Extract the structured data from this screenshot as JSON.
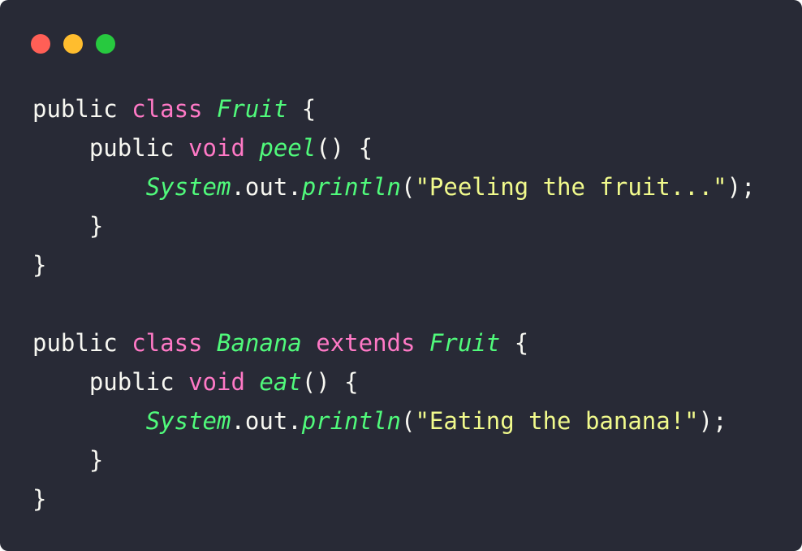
{
  "window": {
    "controls": [
      {
        "name": "close",
        "color": "#ff5f56"
      },
      {
        "name": "minimize",
        "color": "#ffbd2e"
      },
      {
        "name": "maximize",
        "color": "#27c93f"
      }
    ],
    "background": "#282a36"
  },
  "code": {
    "language": "java",
    "lines": [
      [
        {
          "t": "public ",
          "k": "plain"
        },
        {
          "t": "class",
          "k": "kw"
        },
        {
          "t": " ",
          "k": "plain"
        },
        {
          "t": "Fruit",
          "k": "type"
        },
        {
          "t": " {",
          "k": "plain"
        }
      ],
      [
        {
          "t": "    public ",
          "k": "plain"
        },
        {
          "t": "void",
          "k": "kw"
        },
        {
          "t": " ",
          "k": "plain"
        },
        {
          "t": "peel",
          "k": "fn"
        },
        {
          "t": "() {",
          "k": "plain"
        }
      ],
      [
        {
          "t": "        ",
          "k": "plain"
        },
        {
          "t": "System",
          "k": "type"
        },
        {
          "t": ".out.",
          "k": "plain"
        },
        {
          "t": "println",
          "k": "fn"
        },
        {
          "t": "(",
          "k": "plain"
        },
        {
          "t": "\"Peeling the fruit...\"",
          "k": "str"
        },
        {
          "t": ");",
          "k": "plain"
        }
      ],
      [
        {
          "t": "    }",
          "k": "plain"
        }
      ],
      [
        {
          "t": "}",
          "k": "plain"
        }
      ],
      [],
      [
        {
          "t": "public ",
          "k": "plain"
        },
        {
          "t": "class",
          "k": "kw"
        },
        {
          "t": " ",
          "k": "plain"
        },
        {
          "t": "Banana",
          "k": "type"
        },
        {
          "t": " ",
          "k": "plain"
        },
        {
          "t": "extends",
          "k": "kw"
        },
        {
          "t": " ",
          "k": "plain"
        },
        {
          "t": "Fruit",
          "k": "type"
        },
        {
          "t": " {",
          "k": "plain"
        }
      ],
      [
        {
          "t": "    public ",
          "k": "plain"
        },
        {
          "t": "void",
          "k": "kw"
        },
        {
          "t": " ",
          "k": "plain"
        },
        {
          "t": "eat",
          "k": "fn"
        },
        {
          "t": "() {",
          "k": "plain"
        }
      ],
      [
        {
          "t": "        ",
          "k": "plain"
        },
        {
          "t": "System",
          "k": "type"
        },
        {
          "t": ".out.",
          "k": "plain"
        },
        {
          "t": "println",
          "k": "fn"
        },
        {
          "t": "(",
          "k": "plain"
        },
        {
          "t": "\"Eating the banana!\"",
          "k": "str"
        },
        {
          "t": ");",
          "k": "plain"
        }
      ],
      [
        {
          "t": "    }",
          "k": "plain"
        }
      ],
      [
        {
          "t": "}",
          "k": "plain"
        }
      ]
    ]
  },
  "colors": {
    "plain": "#f8f8f2",
    "keyword": "#ff79c6",
    "type": "#50fa7b",
    "string": "#f1fa8c"
  }
}
